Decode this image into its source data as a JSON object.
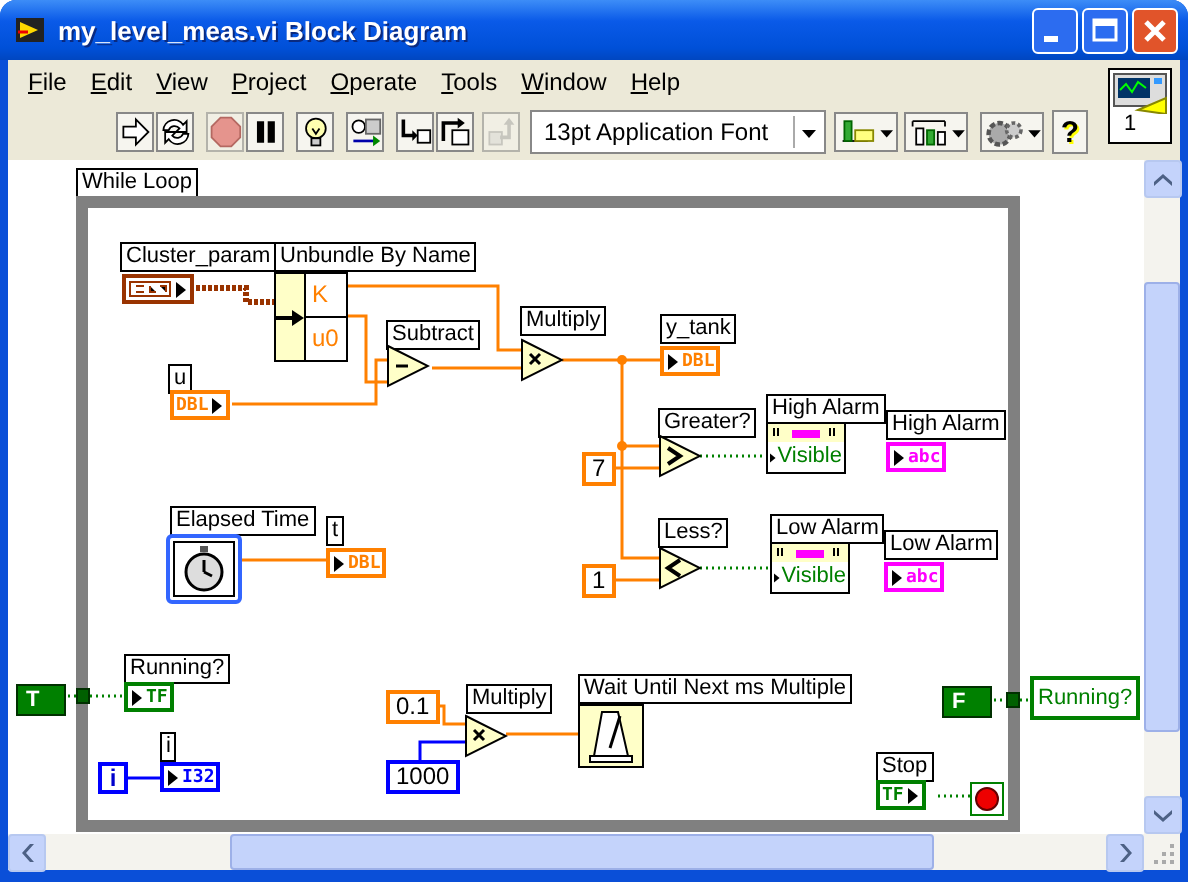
{
  "window": {
    "title": "my_level_meas.vi Block Diagram"
  },
  "menu": [
    {
      "label": "File"
    },
    {
      "label": "Edit"
    },
    {
      "label": "View"
    },
    {
      "label": "Project"
    },
    {
      "label": "Operate"
    },
    {
      "label": "Tools"
    },
    {
      "label": "Window"
    },
    {
      "label": "Help"
    }
  ],
  "toolbar": {
    "items": [
      {
        "kind": "run",
        "disabled": false
      },
      {
        "kind": "run-continuously",
        "disabled": false
      },
      {
        "kind": "abort",
        "disabled": true
      },
      {
        "kind": "pause",
        "disabled": false
      },
      {
        "kind": "highlight",
        "disabled": false
      },
      {
        "kind": "retain",
        "disabled": false
      },
      {
        "kind": "step-into",
        "disabled": false
      },
      {
        "kind": "step-over",
        "disabled": false
      },
      {
        "kind": "step-out",
        "disabled": true
      },
      {
        "kind": "font-menu",
        "label": "13pt Application Font"
      },
      {
        "kind": "align"
      },
      {
        "kind": "distribute"
      },
      {
        "kind": "reorder"
      },
      {
        "kind": "help",
        "label": "?"
      }
    ]
  },
  "icon_pane": {
    "label": "1"
  },
  "diagram": {
    "loop_label": "While Loop",
    "nodes": [
      {
        "kind": "control",
        "label": "Cluster_param",
        "color": "#993300"
      },
      {
        "kind": "unbundle",
        "label": "Unbundle By Name",
        "fields": [
          "K",
          "u0"
        ]
      },
      {
        "kind": "subtract",
        "label": "Subtract"
      },
      {
        "kind": "multiply",
        "label": "Multiply"
      },
      {
        "kind": "control",
        "label": "u",
        "type": "DBL",
        "color": "#ff8000"
      },
      {
        "kind": "indicator",
        "label": "y_tank",
        "type": "DBL",
        "color": "#ff8000"
      },
      {
        "kind": "constant",
        "value": "7",
        "color": "#ff8000"
      },
      {
        "kind": "greater",
        "label": "Greater?"
      },
      {
        "kind": "property",
        "label": "High Alarm",
        "property": "Visible"
      },
      {
        "kind": "indicator",
        "label": "High Alarm",
        "type": "abc",
        "color": "#ff00ff"
      },
      {
        "kind": "constant",
        "value": "1",
        "color": "#ff8000"
      },
      {
        "kind": "less",
        "label": "Less?"
      },
      {
        "kind": "property",
        "label": "Low Alarm",
        "property": "Visible"
      },
      {
        "kind": "indicator",
        "label": "Low Alarm",
        "type": "abc",
        "color": "#ff00ff"
      },
      {
        "kind": "express",
        "label": "Elapsed Time"
      },
      {
        "kind": "indicator",
        "label": "t",
        "type": "DBL",
        "color": "#ff8000"
      },
      {
        "kind": "bool-constant",
        "value": "T",
        "color": "#008000"
      },
      {
        "kind": "indicator",
        "label": "Running?",
        "type": "TF",
        "color": "#008000"
      },
      {
        "kind": "iteration",
        "value": "i",
        "color": "#0000ff"
      },
      {
        "kind": "indicator",
        "label": "i",
        "type": "I32",
        "color": "#0000ff"
      },
      {
        "kind": "constant",
        "value": "0.1",
        "color": "#ff8000"
      },
      {
        "kind": "constant",
        "value": "1000",
        "color": "#0000ff"
      },
      {
        "kind": "multiply",
        "label": "Multiply"
      },
      {
        "kind": "wait",
        "label": "Wait Until Next ms Multiple"
      },
      {
        "kind": "bool-constant",
        "value": "F",
        "color": "#008000"
      },
      {
        "kind": "local",
        "value": "Running?",
        "color": "#008000"
      },
      {
        "kind": "control",
        "label": "Stop",
        "type": "TF",
        "color": "#008000"
      },
      {
        "kind": "stop"
      }
    ]
  }
}
